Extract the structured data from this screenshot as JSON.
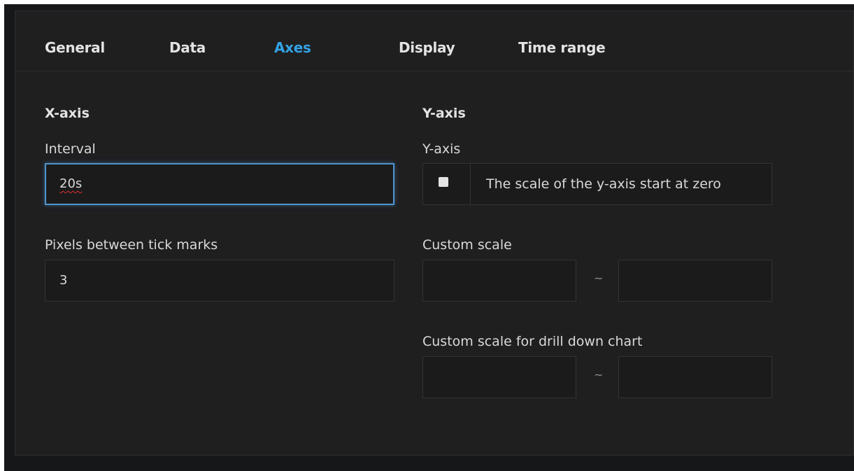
{
  "tabs": [
    {
      "label": "General",
      "active": false
    },
    {
      "label": "Data",
      "active": false
    },
    {
      "label": "Axes",
      "active": true
    },
    {
      "label": "Display",
      "active": false
    },
    {
      "label": "Time range",
      "active": false
    }
  ],
  "xaxis": {
    "title": "X-axis",
    "interval_label": "Interval",
    "interval_value": "20s",
    "ticks_label": "Pixels between tick marks",
    "ticks_value": "3"
  },
  "yaxis": {
    "title": "Y-axis",
    "sub_label": "Y-axis",
    "checkbox_label": "The scale of the y-axis start at zero",
    "checkbox_checked": false,
    "custom_scale_label": "Custom scale",
    "custom_scale_min": "",
    "custom_scale_max": "",
    "drill_scale_label": "Custom scale for drill down chart",
    "drill_scale_min": "",
    "drill_scale_max": "",
    "range_separator": "~"
  },
  "colors": {
    "accent": "#33a2e5",
    "panel_bg": "#1f1f20",
    "focus_border": "#5195ce"
  }
}
